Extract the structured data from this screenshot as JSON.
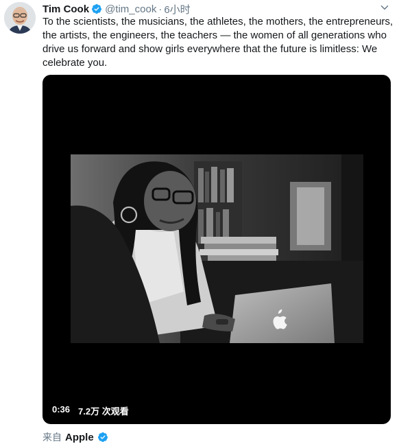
{
  "tweet": {
    "author_name": "Tim Cook",
    "handle": "@tim_cook",
    "separator": "·",
    "time": "6小时",
    "text": "To the scientists, the musicians, the athletes, the mothers, the entrepreneurs, the artists, the engineers, the teachers — the women of all generations who drive us forward and show girls everywhere that the future is limitless: We celebrate you."
  },
  "video": {
    "duration": "0:36",
    "views": "7.2万 次观看"
  },
  "footer": {
    "source_prefix": "来自",
    "source_name": "Apple"
  },
  "icons": {
    "verified": "verified-badge-icon",
    "menu": "chevron-down-icon"
  },
  "colors": {
    "verified": "#1da1f2",
    "secondary_text": "#657786",
    "video_background": "#000000"
  }
}
